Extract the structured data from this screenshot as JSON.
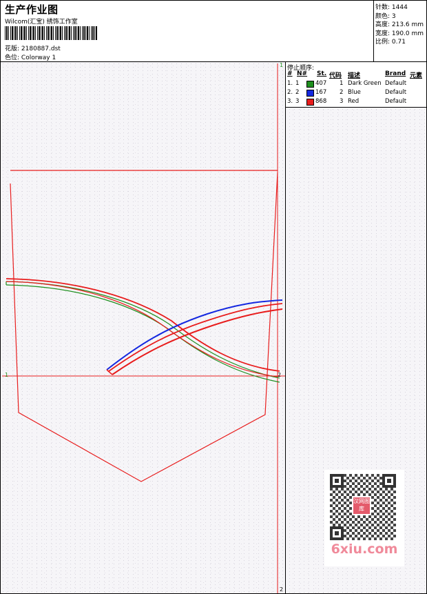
{
  "header": {
    "title": "生产作业图",
    "subtitle": "Wilcom(汇宝) 绣饰工作室",
    "design_label": "花版:",
    "design_file": "2180887.dst",
    "color_label": "色位:",
    "colorway": "Colorway 1"
  },
  "stats": {
    "stitches": "针数: 1444",
    "colors": "颜色: 3",
    "height": "高度: 213.6 mm",
    "width": "宽度: 190.0 mm",
    "scale": "比例: 0.71"
  },
  "stop_sequence": {
    "title": "停止顺序:",
    "columns": [
      "#",
      "N#",
      "St.",
      "代码",
      "描述",
      "Brand",
      "元素"
    ],
    "rows": [
      {
        "num": "1.",
        "n": "1",
        "stitches": "407",
        "code": "1",
        "description": "Dark Green",
        "brand": "Default",
        "color": "#1e8f1e"
      },
      {
        "num": "2.",
        "n": "2",
        "stitches": "167",
        "code": "2",
        "description": "Blue",
        "brand": "Default",
        "color": "#1428e0"
      },
      {
        "num": "3.",
        "n": "3",
        "stitches": "868",
        "code": "3",
        "description": "Red",
        "brand": "Default",
        "color": "#e81c1c"
      }
    ]
  },
  "canvas": {
    "marker_top": "1",
    "marker_left": "1",
    "marker_right": "2",
    "marker_bottom": "2",
    "pocket_color": "#e81c1c",
    "line_color": "#e81c1c"
  },
  "watermark": {
    "logo_text": "汉网图库",
    "site": "6xiu.com"
  }
}
